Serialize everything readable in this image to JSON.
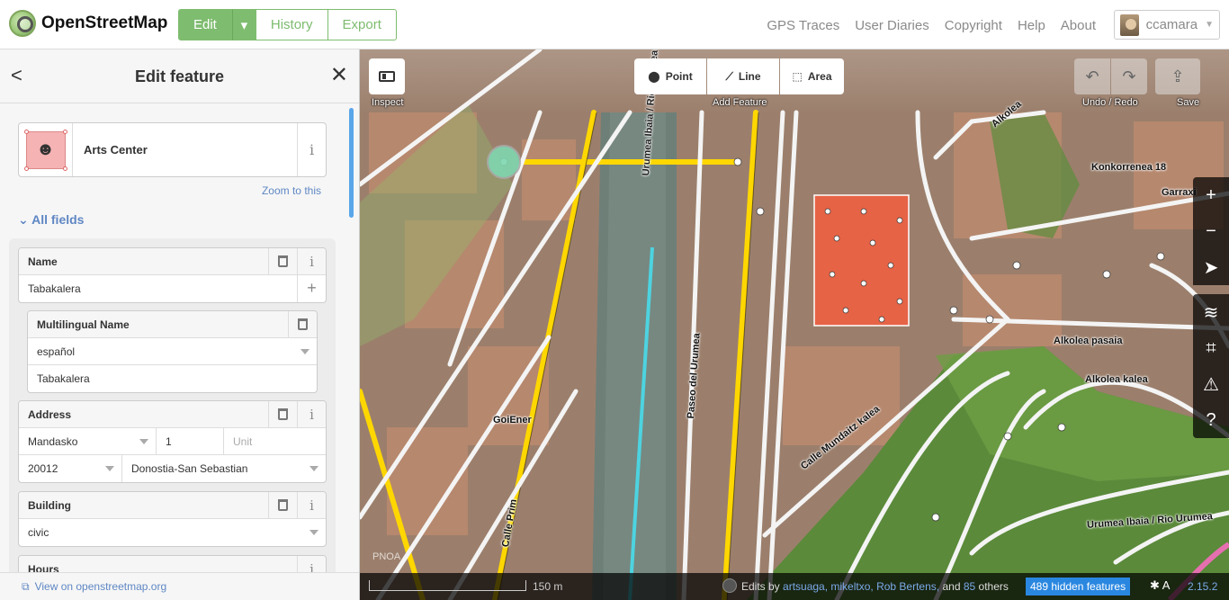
{
  "header": {
    "logo_text": "OpenStreetMap",
    "edit": "Edit",
    "history": "History",
    "export": "Export",
    "nav": [
      "GPS Traces",
      "User Diaries",
      "Copyright",
      "Help",
      "About"
    ],
    "username": "ccamara"
  },
  "sidebar": {
    "title": "Edit feature",
    "preset_name": "Arts Center",
    "zoom_link": "Zoom to this",
    "all_fields": "All fields",
    "fields": {
      "name": {
        "label": "Name",
        "value": "Tabakalera"
      },
      "multilingual": {
        "label": "Multilingual Name",
        "language": "español",
        "value": "Tabakalera"
      },
      "address": {
        "label": "Address",
        "street": "Mandasko",
        "number": "1",
        "unit_placeholder": "Unit",
        "postcode": "20012",
        "city": "Donostia-San Sebastian"
      },
      "building": {
        "label": "Building",
        "value": "civic"
      },
      "hours": {
        "label": "Hours"
      }
    },
    "footer_link": "View on openstreetmap.org"
  },
  "map": {
    "toolbar": {
      "inspect": "Inspect",
      "point": "Point",
      "line": "Line",
      "area": "Area",
      "add_feature": "Add Feature",
      "undo_redo": "Undo / Redo",
      "save": "Save"
    },
    "labels": {
      "urumea_river_1": "Urumea Ibaia / Rio Urumea",
      "paseo": "Paseo del Urumea",
      "mundaitz": "Calle Mundaitz kalea",
      "alkolea_pasaia": "Alkolea pasaia",
      "alkolea_kalea": "Alkolea kalea",
      "konkorrenea": "Konkorrenea 18",
      "garraxi": "Garraxi",
      "goiener": "GoiEner",
      "prim": "Calle Prim",
      "urumea_river_2": "Urumea Ibaia / Rio Urumea",
      "top_street": "Alkolea"
    },
    "footer": {
      "scale": "150 m",
      "edits_prefix": "Edits by",
      "users": "artsuaga, mikeltxo, Rob Bertens,",
      "and": "and",
      "others_count": "85",
      "others": "others",
      "hidden": "489 hidden features",
      "version": "2.15.2",
      "pnoa": "PNOA"
    }
  }
}
